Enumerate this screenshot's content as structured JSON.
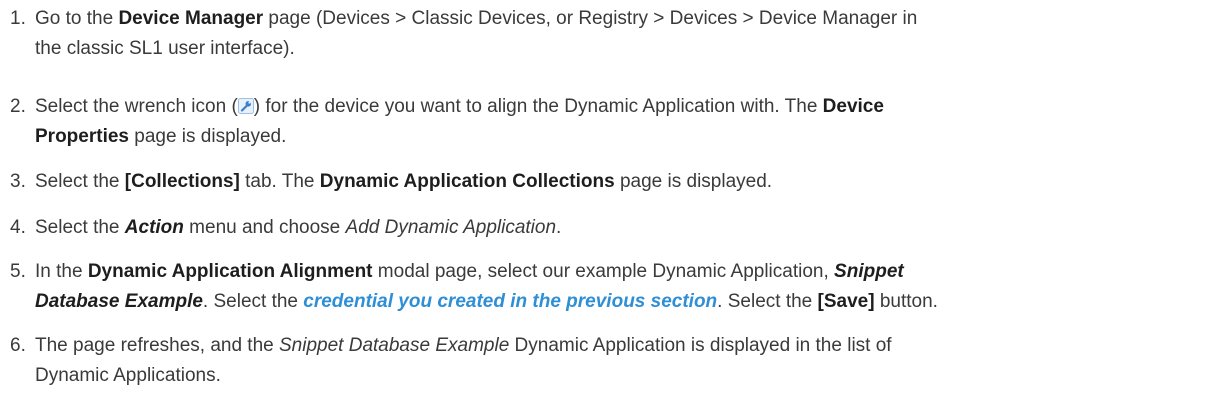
{
  "steps": [
    {
      "number": "1.",
      "lines": [
        [
          "Go to the ",
          "Device Manager",
          " page (Devices > Classic Devices, or Registry > Devices > Device Manager in"
        ],
        [
          "the classic SL1 user interface)."
        ]
      ]
    },
    {
      "number": "2.",
      "lines": [
        [
          "Select the wrench icon (",
          ") for the device you want to align the Dynamic Application with. The ",
          "Device"
        ],
        [
          "Properties",
          " page is displayed."
        ]
      ]
    },
    {
      "number": "3.",
      "lines": [
        [
          "Select the ",
          "[Collections]",
          " tab. The ",
          "Dynamic Application Collections",
          " page is displayed."
        ]
      ]
    },
    {
      "number": "4.",
      "lines": [
        [
          "Select the ",
          "Action",
          " menu and choose ",
          "Add Dynamic Application",
          "."
        ]
      ]
    },
    {
      "number": "5.",
      "lines": [
        [
          "In the ",
          "Dynamic Application Alignment",
          " modal page, select our example Dynamic Application, ",
          "Snippet"
        ],
        [
          "Database Example",
          ". Select the ",
          "credential you created in the previous section",
          ". Select the ",
          "[Save]",
          " button."
        ]
      ]
    },
    {
      "number": "6.",
      "lines": [
        [
          "The page refreshes, and the ",
          "Snippet Database Example",
          "  Dynamic Application is displayed in the list of"
        ],
        [
          "Dynamic Applications."
        ]
      ]
    }
  ],
  "icons": {
    "wrench": "wrench-icon"
  },
  "colors": {
    "text": "#3a3a3a",
    "emphasis": "#1e1e1e",
    "link": "#2f8fd6",
    "wrench": "#3b7fc9"
  }
}
